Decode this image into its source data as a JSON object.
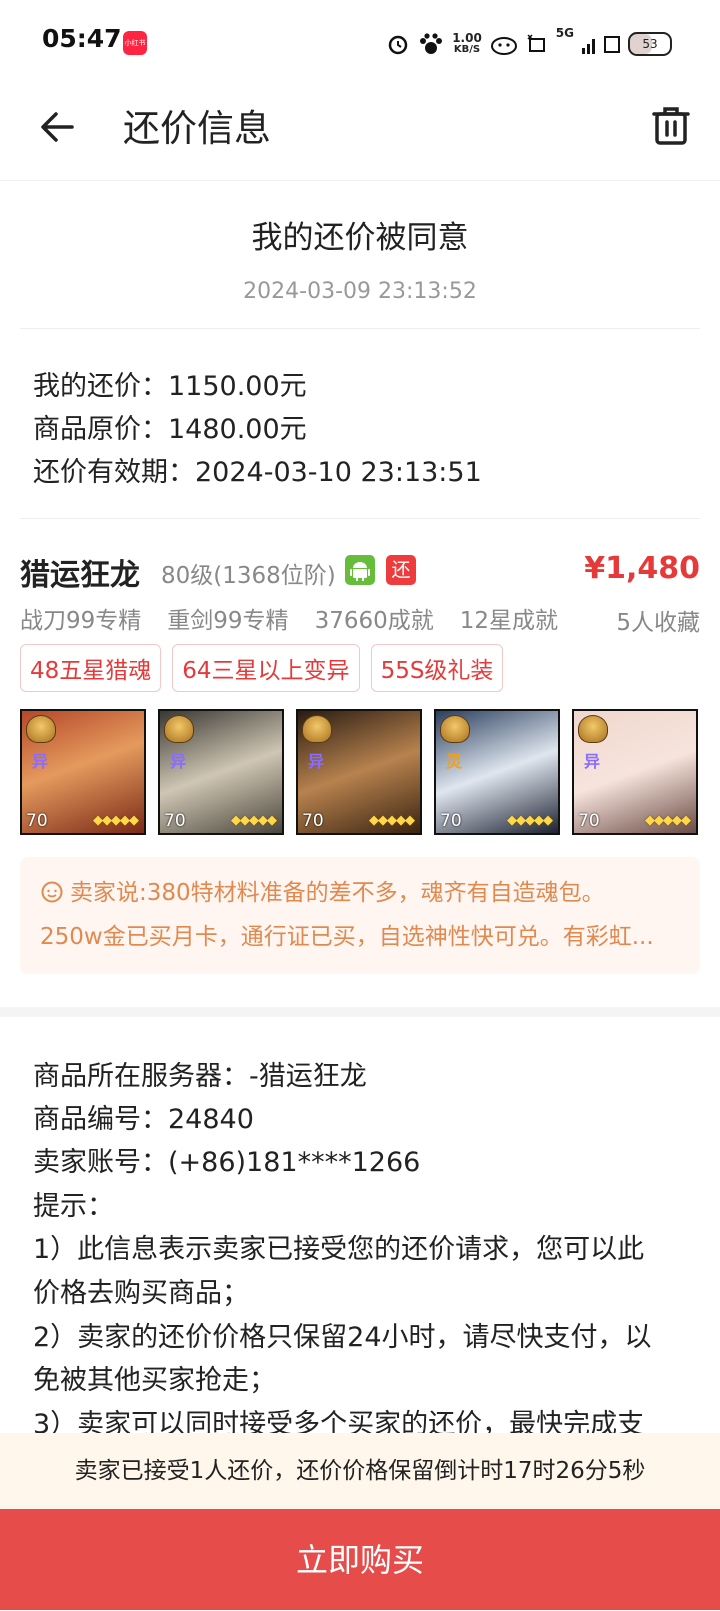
{
  "status_bar": {
    "time": "05:47",
    "app_badge": "小红书",
    "net_speed_value": "1.00",
    "net_speed_unit": "KB/S",
    "signal": "5G",
    "battery": "53"
  },
  "header": {
    "title": "还价信息"
  },
  "notice": {
    "title": "我的还价被同意",
    "time": "2024-03-09 23:13:52"
  },
  "offer": {
    "my_offer": "我的还价：1150.00元",
    "original_price": "商品原价：1480.00元",
    "valid_until": "还价有效期：2024-03-10 23:13:51"
  },
  "goods": {
    "name": "猎运狂龙",
    "level": "80级(1368位阶)",
    "huan_badge": "还",
    "price": "¥1,480",
    "specs": [
      "战刀99专精",
      "重剑99专精",
      "37660成就",
      "12星成就"
    ],
    "favorites": "5人收藏",
    "tags": [
      "48五星猎魂",
      "64三星以上变异",
      "55S级礼装"
    ],
    "heroes": [
      {
        "type": "异",
        "level": "70",
        "type_color": "#8a6cff"
      },
      {
        "type": "异",
        "level": "70",
        "type_color": "#8a6cff"
      },
      {
        "type": "异",
        "level": "70",
        "type_color": "#8a6cff"
      },
      {
        "type": "灵",
        "level": "70",
        "type_color": "#f0a020"
      },
      {
        "type": "异",
        "level": "70",
        "type_color": "#8a6cff"
      }
    ]
  },
  "seller_note": {
    "line1": "卖家说:380特材料准备的差不多，魂齐有自造魂包。",
    "line2": "250w金已买月卡，通行证已买，自选神性快可兑。有彩虹..."
  },
  "details": {
    "server": "商品所在服务器：-猎运狂龙",
    "goods_id": "商品编号：24840",
    "seller_account": "卖家账号：(+86)181****1266",
    "tips_label": "提示：",
    "tip1_a": "1）此信息表示卖家已接受您的还价请求，您可以此",
    "tip1_b": "价格去购买商品；",
    "tip2_a": "2）卖家的还价价格只保留24小时，请尽快支付，以",
    "tip2_b": "免被其他买家抢走；",
    "tip3_a": "3）卖家可以同时接受多个买家的还价，最快完成支"
  },
  "countdown": "卖家已接受1人还价，还价价格保留倒计时17时26分5秒",
  "buy_button": "立即购买",
  "colors": {
    "accent_red": "#e64d4a",
    "price_red": "#e63a3a",
    "note_orange": "#e08a50"
  }
}
